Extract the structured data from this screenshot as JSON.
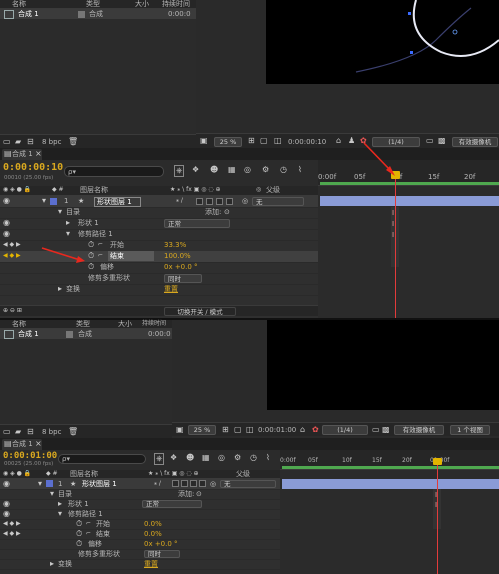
{
  "project_panel_top": {
    "col_name": "名称",
    "col_type": "类型",
    "col_size": "大小",
    "col_duration": "持续时间",
    "item_name": "合成 1",
    "item_type": "合成",
    "item_duration": "0:00:0",
    "bpc": "8 bpc"
  },
  "viewer_top": {
    "zoom": "25 %",
    "timecode": "0:00:00:10",
    "resolution": "(1/4)",
    "camera": "有效摄像机"
  },
  "timeline_top": {
    "tab": "合成 1",
    "timecode": "0:00:00:10",
    "frame_info": "00010 (25.00 fps)",
    "search_placeholder": "ρ▾",
    "col_layer_name": "图层名称",
    "col_parent": "父级",
    "layer_index": "1",
    "layer_name": "形状图层 1",
    "parent_value": "无",
    "contents": "目录",
    "add_label": "添加:",
    "shape_group": "形状 1",
    "shape_mode": "正常",
    "trim_paths": "修剪路径 1",
    "start_label": "开始",
    "start_value": "33.3%",
    "end_label": "结束",
    "end_value": "100.0%",
    "offset_label": "偏移",
    "offset_value": "0x +0.0 °",
    "multi_trim_label": "修剪多重形状",
    "multi_trim_value": "同时",
    "transform_label": "变换",
    "transform_value": "重置",
    "toggle_modes": "切换开关 / 模式",
    "ruler": [
      "0:00f",
      "05f",
      "10f",
      "15f",
      "20f"
    ]
  },
  "project_panel_bottom": {
    "col_name": "名称",
    "col_type": "类型",
    "col_size": "大小",
    "col_duration": "持续时间",
    "item_name": "合成 1",
    "item_type": "合成",
    "item_duration": "0:00:0",
    "bpc": "8 bpc"
  },
  "viewer_bottom": {
    "zoom": "25 %",
    "timecode": "0:00:01:00",
    "resolution": "(1/4)",
    "camera": "有效摄像机",
    "view_count": "1 个视图"
  },
  "timeline_bottom": {
    "tab": "合成 1",
    "timecode": "0:00:01:00",
    "frame_info": "00025 (25.00 fps)",
    "search_placeholder": "ρ▾",
    "col_layer_name": "图层名称",
    "col_parent": "父级",
    "layer_index": "1",
    "layer_name": "形状图层 1",
    "parent_value": "无",
    "contents": "目录",
    "add_label": "添加:",
    "shape_group": "形状 1",
    "shape_mode": "正常",
    "trim_paths": "修剪路径 1",
    "start_label": "开始",
    "start_value": "0.0%",
    "end_label": "结束",
    "end_value": "0.0%",
    "offset_label": "偏移",
    "offset_value": "0x +0.0 °",
    "multi_trim_label": "修剪多重形状",
    "multi_trim_value": "同时",
    "transform_label": "变换",
    "transform_value": "重置",
    "ruler": [
      "0:00f",
      "05f",
      "10f",
      "15f",
      "20f",
      "01:00f"
    ]
  },
  "colors": {
    "timecode": "#d9a81f",
    "playhead": "#e23b3b",
    "layer_bar": "#8a9bd6",
    "label_blue": "#5b6fcf",
    "annotation_arrow": "#e8281e",
    "work_area": "#4fa84f"
  }
}
